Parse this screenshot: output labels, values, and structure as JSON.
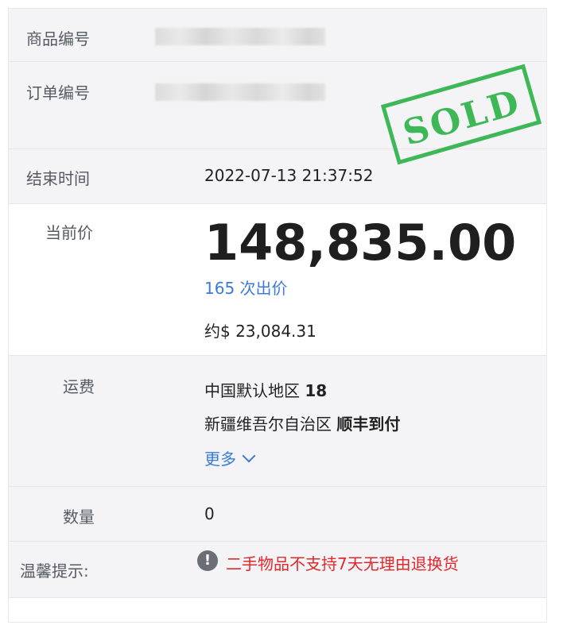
{
  "rows": {
    "item_id": {
      "label": "商品编号"
    },
    "order_id": {
      "label": "订单编号"
    },
    "end_time": {
      "label": "结束时间",
      "value": "2022-07-13 21:37:52"
    },
    "current_price": {
      "label": "当前价",
      "price": "148,835.00",
      "bid_count": "165 次出价",
      "approx_usd": "约$ 23,084.31"
    },
    "shipping": {
      "label": "运费",
      "line1_region": "中国默认地区",
      "line1_value": "18",
      "line2_region": "新疆维吾尔自治区",
      "line2_value": "顺丰到付",
      "more_label": "更多"
    },
    "quantity": {
      "label": "数量",
      "value": "0"
    },
    "notice": {
      "label": "温馨提示:",
      "icon": "!",
      "text": "二手物品不支持7天无理由退换货"
    }
  },
  "stamp": {
    "text": "SOLD",
    "color": "#2fb34a"
  },
  "colors": {
    "link": "#3a7bd5",
    "warning": "#e3272b",
    "section_bg": "#f4f4f6"
  }
}
